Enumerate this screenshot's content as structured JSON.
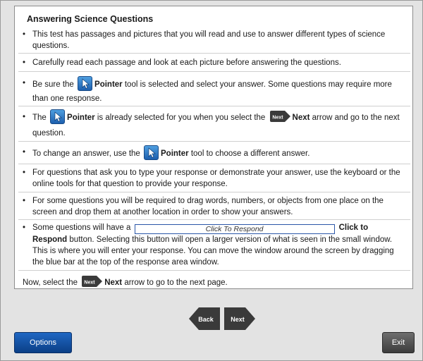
{
  "title": "Answering Science Questions",
  "bullet_char": "•",
  "bullets": {
    "b1": "This test has passages and pictures that you will read and use to answer different types of science questions.",
    "b2": "Carefully read each passage and look at each picture before answering the questions.",
    "b3": {
      "pre": "Be sure the",
      "bold": "Pointer",
      "post": "tool is selected and select your answer. Some questions may require more than one response."
    },
    "b4": {
      "pre": "The",
      "bold1": "Pointer",
      "mid": "is already selected for you when you select the",
      "bold2": "Next",
      "post": "arrow and go to the next question."
    },
    "b5": {
      "pre": "To change an answer, use the",
      "bold": "Pointer",
      "post": "tool to choose a different answer."
    },
    "b6": "For questions that ask you to type your response or demonstrate your answer, use the keyboard or the online tools for that question to provide your response.",
    "b7": "For some questions you will be required to drag words, numbers, or objects from one place on the screen and drop them at another location in order to show your answers.",
    "b8": {
      "pre": "Some questions will have a",
      "button": "Click To Respond",
      "bold": "Click to Respond",
      "post": "button. Selecting this button will open a larger version of what is seen in the small window. This is where you will enter your response. You can move the window around the screen by dragging the blue bar at the top of the response area window."
    }
  },
  "final": {
    "pre": "Now, select the",
    "bold": "Next",
    "post": "arrow to go to the next page."
  },
  "icons": {
    "next_small": "Next",
    "back": "Back",
    "next": "Next"
  },
  "footer": {
    "options": "Options",
    "exit": "Exit"
  },
  "colors": {
    "pointer_blue": "#1d5fae",
    "options_blue": "#0b3f86",
    "arrow_dark": "#3a3a3a"
  }
}
